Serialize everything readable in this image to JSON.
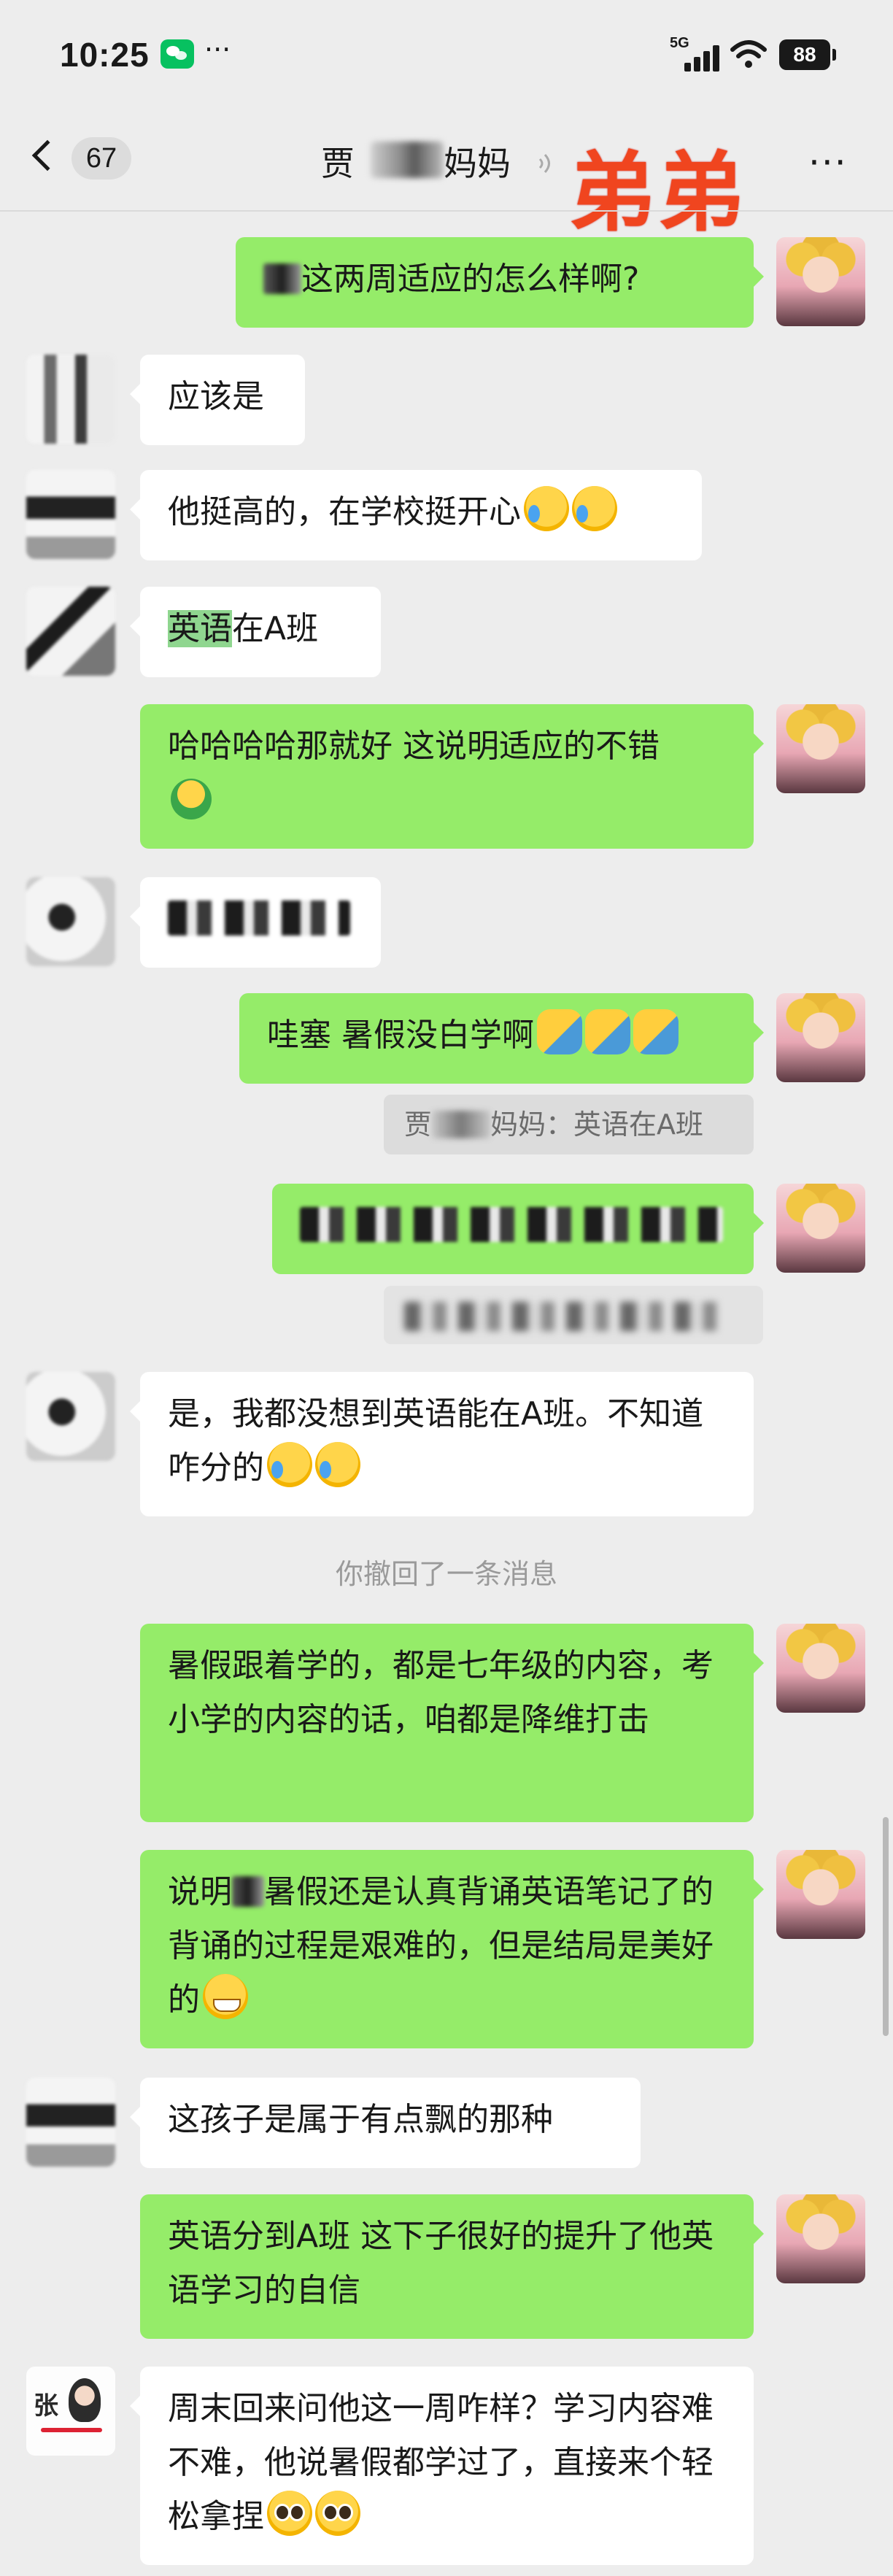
{
  "status_bar": {
    "time": "10:25",
    "more": "···",
    "network": "5G",
    "battery": "88"
  },
  "nav": {
    "unread_count": "67",
    "title_left": "贾",
    "title_right": "妈妈",
    "overlay_tag": "弟弟",
    "more": "···"
  },
  "messages": [
    {
      "side": "out",
      "text": "这两周适应的怎么样啊?"
    },
    {
      "side": "in",
      "text": "应该是"
    },
    {
      "side": "in",
      "text": "他挺高的，在学校挺开心"
    },
    {
      "side": "in",
      "highlight": "英语",
      "text": "在A班"
    },
    {
      "side": "out",
      "text": "哈哈哈哈那就好 这说明适应的不错"
    },
    {
      "side": "out",
      "text": "哇塞 暑假没白学啊"
    },
    {
      "side": "out",
      "quote_prefix": "贾",
      "quote_text": "妈妈：英语在A班"
    },
    {
      "side": "in",
      "text": "是，我都没想到英语能在A班。不知道咋分的"
    },
    {
      "side": "out",
      "text": "暑假跟着学的，都是七年级的内容，考小学的内容的话，咱都是降维打击"
    },
    {
      "side": "out",
      "text_a": "说明",
      "text_b": "暑假还是认真背诵英语笔记了的 背诵的过程是艰难的，但是结局是美好的"
    },
    {
      "side": "in",
      "text": "这孩子是属于有点飘的那种"
    },
    {
      "side": "out",
      "text": "英语分到A班 这下子很好的提升了他英语学习的自信"
    },
    {
      "side": "in",
      "text": "周末回来问他这一周咋样？学习内容难不难，他说暑假都学过了，直接来个轻松拿捏"
    }
  ],
  "system": {
    "recall_notice": "你撤回了一条消息"
  },
  "avatar_zhang_text": "张",
  "icons": [
    "back-chevron-icon",
    "wechat-icon",
    "signal-icon",
    "wifi-icon",
    "battery-icon",
    "voice-icon",
    "more-icon"
  ]
}
